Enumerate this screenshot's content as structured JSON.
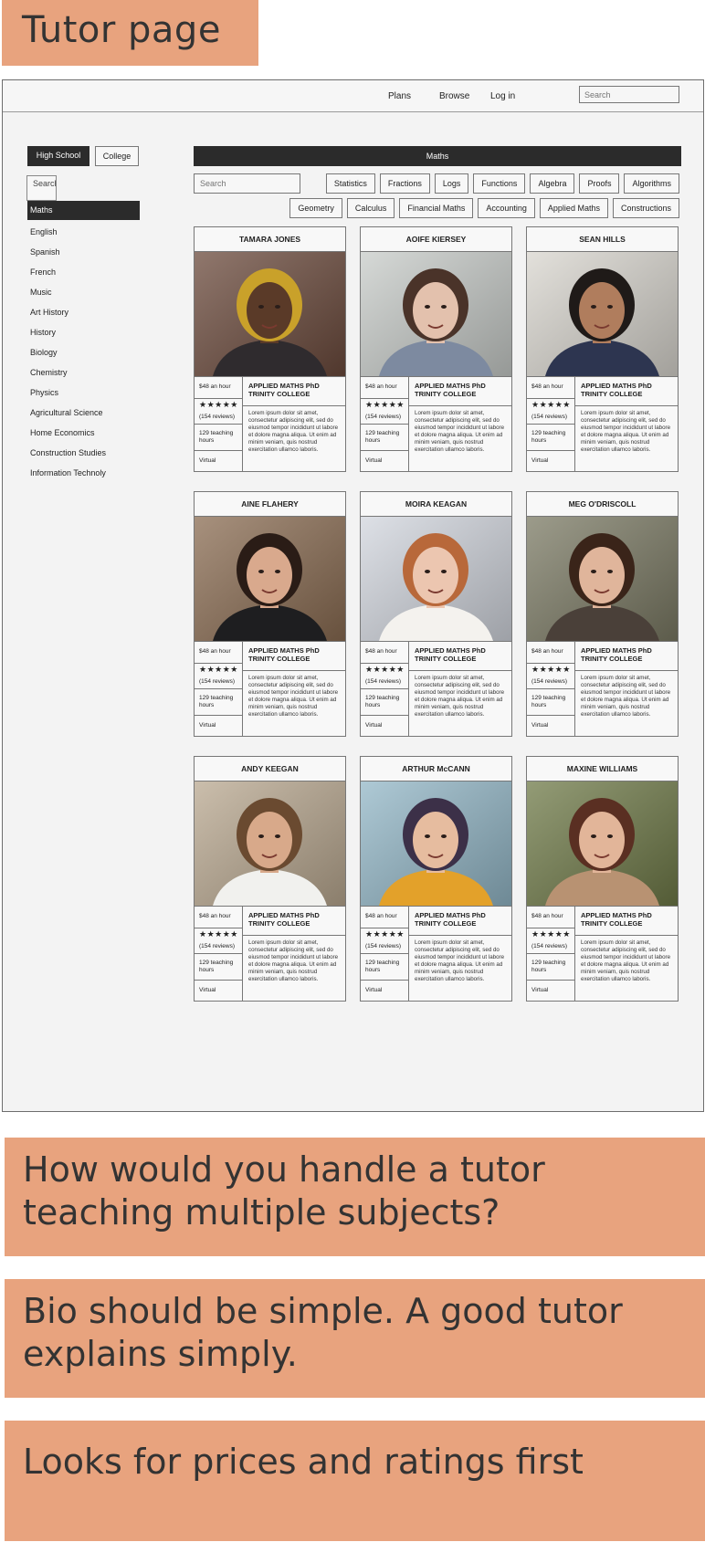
{
  "notes": {
    "title": "Tutor page",
    "comment_1": "How would you handle a tutor teaching multiple subjects?",
    "comment_2": "Bio should be simple. A good tutor explains simply.",
    "comment_3": "Looks for prices and ratings first"
  },
  "nav": {
    "plans": "Plans",
    "browse": "Browse",
    "login": "Log in",
    "search_placeholder": "Search"
  },
  "level_toggle": {
    "high_school": "High School",
    "college": "College"
  },
  "sidebar": {
    "search_placeholder": "Search",
    "items": [
      {
        "label": "Maths",
        "active": true
      },
      {
        "label": "English"
      },
      {
        "label": "Spanish"
      },
      {
        "label": "French"
      },
      {
        "label": "Music"
      },
      {
        "label": "Art History"
      },
      {
        "label": "History"
      },
      {
        "label": "Biology"
      },
      {
        "label": "Chemistry"
      },
      {
        "label": "Physics"
      },
      {
        "label": "Agricultural Science"
      },
      {
        "label": "Home Economics"
      },
      {
        "label": "Construction Studies"
      },
      {
        "label": "Information Technoly"
      }
    ]
  },
  "main": {
    "subject_title": "Maths",
    "search_placeholder": "Search",
    "filters_row1": [
      "Statistics",
      "Fractions",
      "Logs",
      "Functions",
      "Algebra",
      "Proofs",
      "Algorithms"
    ],
    "filters_row2": [
      "Geometry",
      "Calculus",
      "Financial Maths",
      "Accounting",
      "Applied Maths",
      "Constructions"
    ]
  },
  "card_defaults": {
    "price": "$48 an hour",
    "stars": "★★★★★",
    "reviews": "(154 reviews)",
    "hours": "129 teaching hours",
    "mode": "Virtual",
    "course": "APPLIED MATHS PhD\nTRINITY COLLEGE",
    "bio": "Lorem ipsum dolor sit amet, consectetur adipiscing elit, sed do eiusmod tempor incididunt ut labore et dolore magna aliqua. Ut enim ad minim veniam, quis nostrud exercitation ullamco laboris."
  },
  "tutors": [
    {
      "name": "TAMARA JONES",
      "bg": "#6b4a3c",
      "skin": "#5a3a28",
      "hair": "#c9a12a",
      "shirt": "#2f2b2e"
    },
    {
      "name": "AOIFE KIERSEY",
      "bg": "#c8ccc9",
      "skin": "#e3c1ad",
      "hair": "#4a3329",
      "shirt": "#7d8aa0"
    },
    {
      "name": "SEAN HILLS",
      "bg": "#d9d6cf",
      "skin": "#b07d5d",
      "hair": "#1f1a18",
      "shirt": "#2d3550"
    },
    {
      "name": "AINE FLAHERY",
      "bg": "#8a6c52",
      "skin": "#d9a98d",
      "hair": "#2a1c16",
      "shirt": "#1e1e20"
    },
    {
      "name": "MOIRA KEAGAN",
      "bg": "#d2d6de",
      "skin": "#ecc6b0",
      "hair": "#b8683a",
      "shirt": "#f4f2ee"
    },
    {
      "name": "MEG O'DRISCOLL",
      "bg": "#7b7a64",
      "skin": "#e0b59b",
      "hair": "#3a2419",
      "shirt": "#4a4039"
    },
    {
      "name": "ANDY KEEGAN",
      "bg": "#b9a890",
      "skin": "#d8a98a",
      "hair": "#6a4a30",
      "shirt": "#f1f1ee"
    },
    {
      "name": "ARTHUR McCANN",
      "bg": "#93b7c7",
      "skin": "#e6bc9f",
      "hair": "#3c3048",
      "shirt": "#e3a12a"
    },
    {
      "name": "MAXINE WILLIAMS",
      "bg": "#6f7a48",
      "skin": "#e2b599",
      "hair": "#5a2f22",
      "shirt": "#b89272"
    }
  ]
}
